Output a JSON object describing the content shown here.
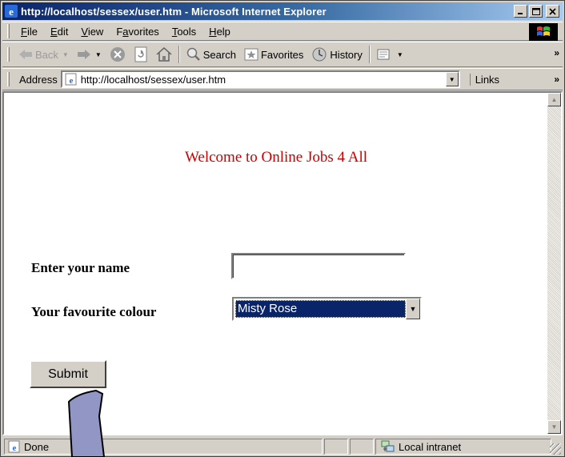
{
  "window": {
    "title": "http://localhost/sessex/user.htm - Microsoft Internet Explorer",
    "controls": [
      "_",
      "□",
      "×"
    ]
  },
  "menu": {
    "items": [
      {
        "label": "File",
        "key": "F",
        "rest": "ile"
      },
      {
        "label": "Edit",
        "key": "E",
        "rest": "dit"
      },
      {
        "label": "View",
        "key": "V",
        "rest": "iew"
      },
      {
        "label": "Favorites",
        "pre": "F",
        "key": "a",
        "rest": "vorites"
      },
      {
        "label": "Tools",
        "key": "T",
        "rest": "ools"
      },
      {
        "label": "Help",
        "key": "H",
        "rest": "elp"
      }
    ]
  },
  "toolbar": {
    "back": "Back",
    "search": "Search",
    "favorites": "Favorites",
    "history": "History"
  },
  "address": {
    "label": "Address",
    "url": "http://localhost/sessex/user.htm",
    "links": "Links"
  },
  "page": {
    "heading": "Welcome to Online Jobs 4 All",
    "name_label": "Enter your name",
    "name_value": "",
    "colour_label": "Your favourite colour",
    "colour_selected": "Misty Rose",
    "submit_label": "Submit"
  },
  "status": {
    "text": "Done",
    "zone": "Local intranet"
  },
  "colors": {
    "heading": "#cc0000",
    "selection": "#0a246a",
    "chrome": "#d4d0c8"
  }
}
